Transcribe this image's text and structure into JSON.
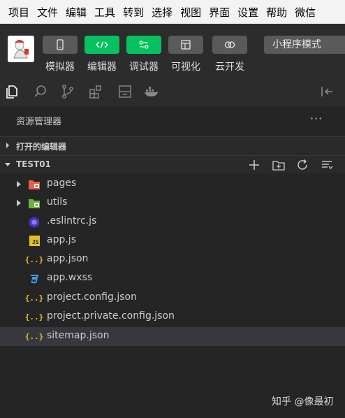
{
  "menubar": {
    "items": [
      "项目",
      "文件",
      "编辑",
      "工具",
      "转到",
      "选择",
      "视图",
      "界面",
      "设置",
      "帮助",
      "微信"
    ]
  },
  "toolbar": {
    "buttons": [
      {
        "label": "模拟器",
        "icon": "phone-icon",
        "active": false
      },
      {
        "label": "编辑器",
        "icon": "code-icon",
        "active": true
      },
      {
        "label": "调试器",
        "icon": "debug-toggle-icon",
        "active": true
      },
      {
        "label": "可视化",
        "icon": "layout-icon",
        "active": false
      },
      {
        "label": "云开发",
        "icon": "cloud-icon",
        "active": false
      }
    ],
    "mode": "小程序模式"
  },
  "explorer": {
    "title": "资源管理器",
    "more": "···",
    "open_editors": "打开的编辑器",
    "project": "TEST01"
  },
  "tree": [
    {
      "name": "pages",
      "type": "folder"
    },
    {
      "name": "utils",
      "type": "folder"
    },
    {
      "name": ".eslintrc.js",
      "type": "eslint"
    },
    {
      "name": "app.js",
      "type": "js"
    },
    {
      "name": "app.json",
      "type": "json"
    },
    {
      "name": "app.wxss",
      "type": "css"
    },
    {
      "name": "project.config.json",
      "type": "json"
    },
    {
      "name": "project.private.config.json",
      "type": "json"
    },
    {
      "name": "sitemap.json",
      "type": "json",
      "selected": true
    }
  ],
  "icons": {
    "js_badge": "JS",
    "json_badge": "{..}"
  },
  "watermark": "知乎 @像最初",
  "colors": {
    "accent_green": "#07c160",
    "folder_pages": "#e8604c",
    "folder_utils": "#6cb33e",
    "js": "#e6c229",
    "json": "#e6c229",
    "css": "#3c9ee5",
    "eslint": "#4b32c3"
  }
}
